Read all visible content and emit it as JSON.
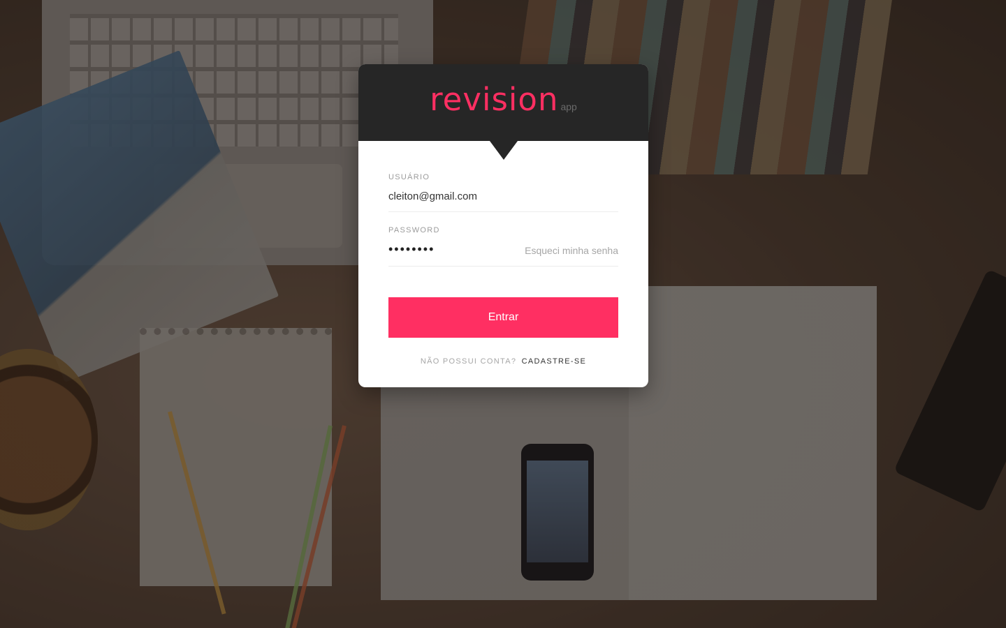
{
  "brand": {
    "name": "revision",
    "suffix": "app",
    "accent": "#ff2f62",
    "header_bg": "#262626"
  },
  "form": {
    "username": {
      "label": "USUÁRIO",
      "value": "cleiton@gmail.com"
    },
    "password": {
      "label": "PASSWORD",
      "masked_value": "••••••••",
      "forgot_label": "Esqueci minha senha"
    },
    "submit_label": "Entrar"
  },
  "signup": {
    "question": "NÃO POSSUI CONTA?",
    "link_label": "CADASTRE-SE"
  }
}
